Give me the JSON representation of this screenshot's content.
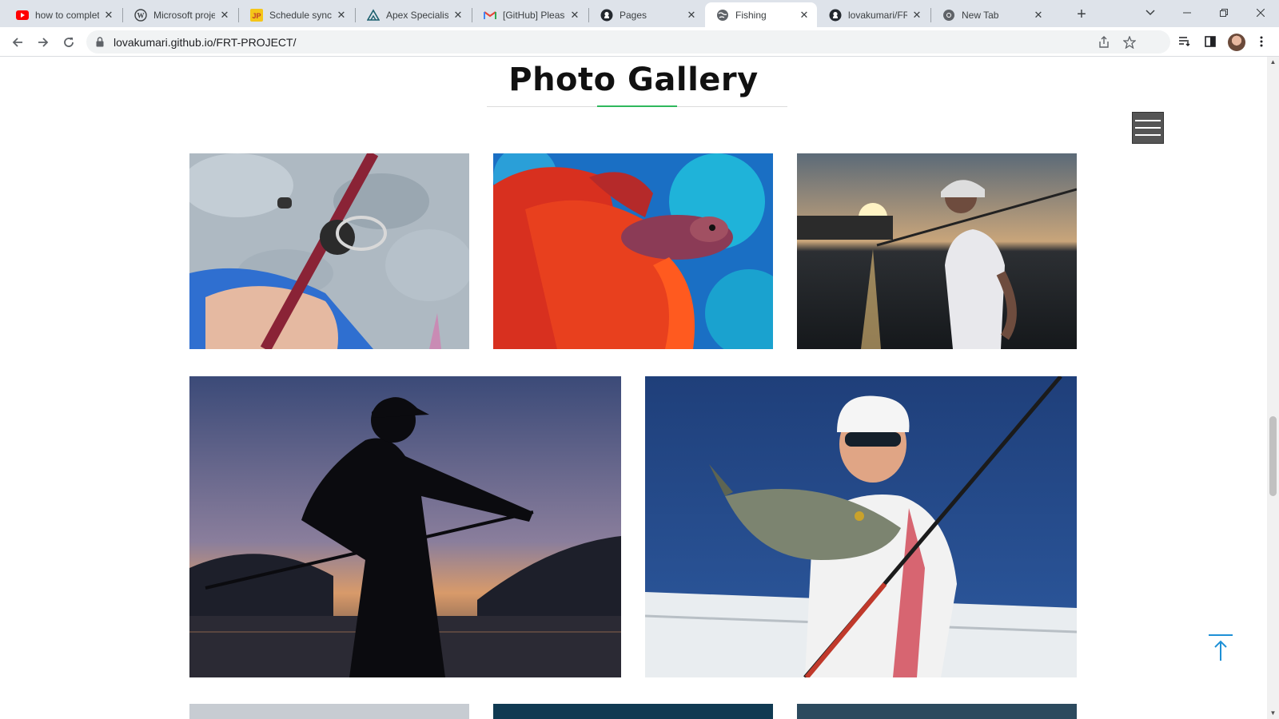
{
  "browser": {
    "tabs": [
      {
        "title": "how to complet",
        "icon": "youtube-icon",
        "active": false
      },
      {
        "title": "Microsoft proje",
        "icon": "wordpress-icon",
        "active": false
      },
      {
        "title": "Schedule synch",
        "icon": "jp-icon",
        "active": false
      },
      {
        "title": "Apex Specialist",
        "icon": "trailhead-icon",
        "active": false
      },
      {
        "title": "[GitHub] Please",
        "icon": "gmail-icon",
        "active": false
      },
      {
        "title": "Pages",
        "icon": "github-icon",
        "active": false
      },
      {
        "title": "Fishing",
        "icon": "globe-icon",
        "active": true
      },
      {
        "title": "lovakumari/FRT",
        "icon": "github-icon",
        "active": false
      },
      {
        "title": "New Tab",
        "icon": "chrome-icon",
        "active": false
      }
    ],
    "url": "lovakumari.github.io/FRT-PROJECT/"
  },
  "gallery": {
    "heading": "Photo Gallery",
    "accent_color": "#2eb85c",
    "photos": [
      {
        "subject": "fishing reel close-up"
      },
      {
        "subject": "red betta fish"
      },
      {
        "subject": "angler at sunset"
      },
      {
        "subject": "silhouette fisherman"
      },
      {
        "subject": "man holding sea bass"
      }
    ]
  },
  "colors": {
    "tabstrip": "#dee3ea",
    "hamburger": "#555555",
    "back_to_top": "#1e90d6"
  }
}
